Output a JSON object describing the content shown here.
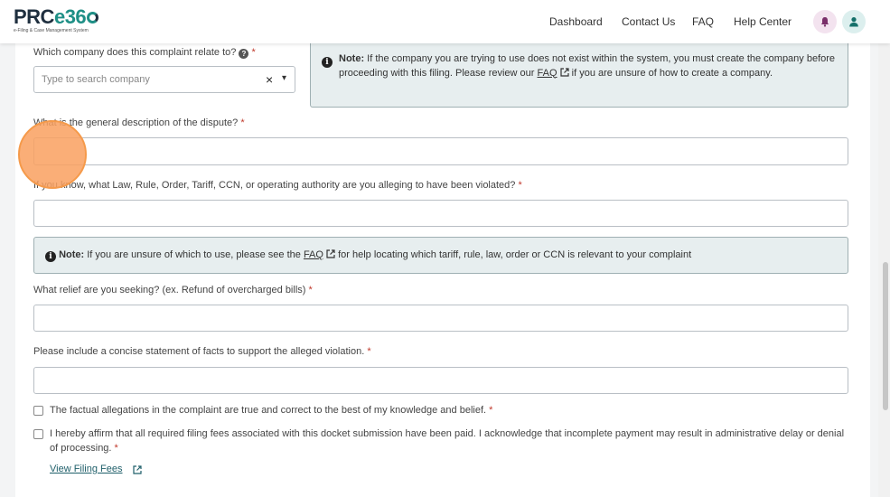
{
  "app": {
    "logo_text": "PRCe360",
    "logo_main": "PRC",
    "logo_accent": "e36",
    "logo_tagline": "e-Filing & Case Management System"
  },
  "nav": {
    "dashboard": "Dashboard",
    "contact_us": "Contact Us",
    "faq": "FAQ",
    "help_center": "Help Center"
  },
  "form": {
    "company": {
      "label": "Which company does this complaint relate to?",
      "required": "*",
      "placeholder": "Type to search company",
      "clear": "×",
      "caret": "▾"
    },
    "company_note": {
      "bold": "Note:",
      "text_before": " If the company you are trying to use does not exist within the system, you must create the company before proceeding with this filing. Please review our ",
      "link": "FAQ",
      "text_after": " if you are unsure of how to create a company."
    },
    "dispute": {
      "label": "What is the general description of the dispute?",
      "required": "*",
      "value": ""
    },
    "law": {
      "label": "If you know, what Law, Rule, Order, Tariff, CCN, or operating authority are you alleging to have been violated?",
      "required": "*",
      "value": ""
    },
    "law_note": {
      "bold": "Note:",
      "text_before": " If you are unsure of which to use, please see the ",
      "link": "FAQ",
      "text_after": " for help locating which tariff, rule, law, order or CCN is relevant to your complaint"
    },
    "relief": {
      "label": "What relief are you seeking? (ex. Refund of overcharged bills)",
      "required": "*",
      "value": ""
    },
    "facts": {
      "label": "Please include a concise statement of facts to support the alleged violation.",
      "required": "*",
      "value": ""
    },
    "affirm_true": {
      "text": "The factual allegations in the complaint are true and correct to the best of my knowledge and belief.",
      "required": "*",
      "checked": false
    },
    "affirm_fees": {
      "text": "I hereby affirm that all required filing fees associated with this docket submission have been paid. I acknowledge that incomplete payment may result in administrative delay or denial of processing.",
      "required": "*",
      "checked": false
    },
    "view_fees": "View Filing Fees"
  },
  "colors": {
    "accent": "#1f8f86",
    "note_bg": "#e7eeef",
    "required": "#c0392b",
    "cursor": "#f9a05f"
  }
}
